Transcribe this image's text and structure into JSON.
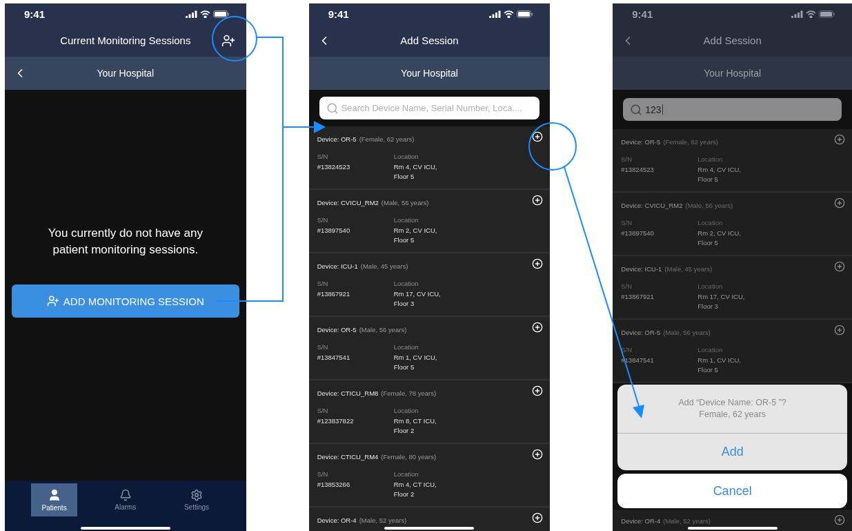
{
  "screens": [
    {
      "kind": "sessions",
      "time": "9:41",
      "title": "Current Monitoring Sessions",
      "subtitle": "Your Hospital",
      "empty_message": "You currently do not have any patient monitoring sessions.",
      "add_button": "ADD MONITORING SESSION",
      "tabs": [
        {
          "kind": "patients",
          "label": "Patients",
          "selected": true
        },
        {
          "kind": "alarms",
          "label": "Alarms",
          "selected": false
        },
        {
          "kind": "settings",
          "label": "Settings",
          "selected": false
        }
      ]
    },
    {
      "kind": "add",
      "dimmed": false,
      "time": "9:41",
      "title": "Add Session",
      "subtitle": "Your Hospital",
      "search": {
        "placeholder": "Search Device Name, Serial Number, Loca...."
      },
      "devices": [
        {
          "device": "Device: OR-5",
          "patient": "(Female, 62 years)",
          "sn_label": "S/N",
          "sn": "#13824523",
          "location_label": "Location",
          "location": "Rm 4, CV ICU,\nFloor 5"
        },
        {
          "device": "Device: CVICU_RM2",
          "patient": "(Male, 56 years)",
          "sn_label": "S/N",
          "sn": "#13897540",
          "location_label": "Location",
          "location": "Rm 2, CV ICU,\nFloor 5"
        },
        {
          "device": "Device: ICU-1",
          "patient": "(Male, 45 years)",
          "sn_label": "S/N",
          "sn": "#13867921",
          "location_label": "Location",
          "location": "Rm 17, CV ICU,\nFloor 3"
        },
        {
          "device": "Device: OR-5",
          "patient": "(Male, 56 years)",
          "sn_label": "S/N",
          "sn": "#13847541",
          "location_label": "Location",
          "location": "Rm 1, CV ICU,\nFloor 5"
        },
        {
          "device": "Device: CTICU_RM8",
          "patient": "(Female, 78 years)",
          "sn_label": "S/N",
          "sn": "#123837822",
          "location_label": "Location",
          "location": "Rm 8, CT ICU,\nFloor 2"
        },
        {
          "device": "Device: CTICU_RM4",
          "patient": "(Female, 80 years)",
          "sn_label": "S/N",
          "sn": "#13853266",
          "location_label": "Location",
          "location": "Rm 4, CT ICU,\nFloor 2"
        },
        {
          "device": "Device: OR-4",
          "patient": "(Male, 52 years)"
        }
      ]
    },
    {
      "kind": "add",
      "dimmed": true,
      "time": "9:41",
      "title": "Add Session",
      "subtitle": "Your Hospital",
      "search": {
        "value": "123"
      },
      "devices": [
        {
          "device": "Device: OR-5",
          "patient": "(Female, 62 years)",
          "sn_label": "S/N",
          "sn": "#13824523",
          "location_label": "Location",
          "location": "Rm 4, CV ICU,\nFloor 5"
        },
        {
          "device": "Device: CVICU_RM2",
          "patient": "(Male, 56 years)",
          "sn_label": "S/N",
          "sn": "#13897540",
          "location_label": "Location",
          "location": "Rm 2, CV ICU,\nFloor 5"
        },
        {
          "device": "Device: ICU-1",
          "patient": "(Male, 45 years)",
          "sn_label": "S/N",
          "sn": "#13867921",
          "location_label": "Location",
          "location": "Rm 17, CV ICU,\nFloor 3"
        },
        {
          "device": "Device: OR-5",
          "patient": "(Male, 56 years)",
          "sn_label": "S/N",
          "sn": "#13847541",
          "location_label": "Location",
          "location": "Rm 1, CV ICU,\nFloor 5"
        }
      ],
      "sheet": {
        "message": "Add “Device Name: OR-5 ”?",
        "detail": "Female, 62 years",
        "confirm": "Add",
        "cancel": "Cancel"
      },
      "after_sheet": [
        {
          "device": "Device: OR-4",
          "patient": "(Male, 52 years)"
        }
      ]
    }
  ]
}
